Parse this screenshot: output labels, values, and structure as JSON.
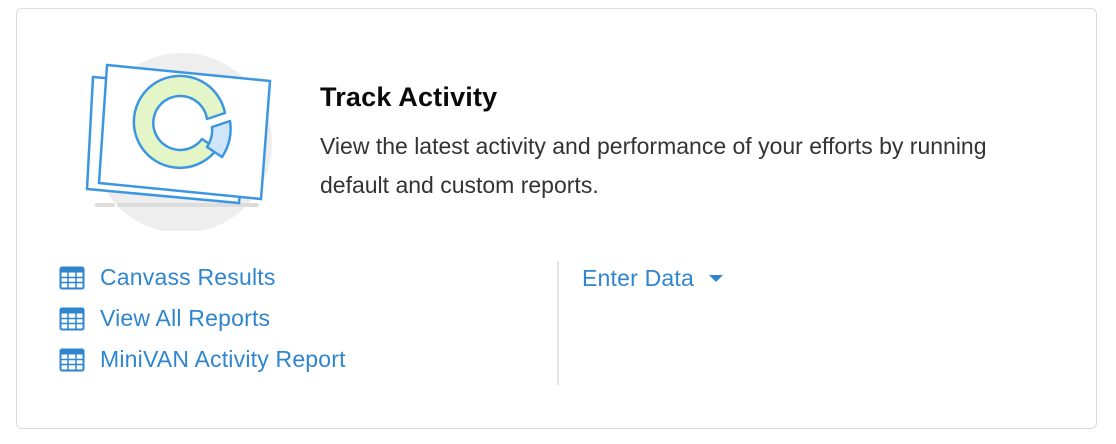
{
  "card": {
    "title": "Track Activity",
    "description": "View the latest activity and performance of your efforts by running default and custom reports.",
    "illustration_icon": "chart-report-illustration"
  },
  "links": [
    {
      "label": "Canvass Results",
      "icon": "table-icon"
    },
    {
      "label": "View All Reports",
      "icon": "table-icon"
    },
    {
      "label": "MiniVAN Activity Report",
      "icon": "table-icon"
    }
  ],
  "enter_data": {
    "label": "Enter Data",
    "icon": "caret-down-icon"
  },
  "colors": {
    "link": "#2f86cf",
    "title": "#0a0a0a",
    "text": "#333333",
    "border": "#dcdcdc",
    "illustration_blue": "#3d97e0",
    "illustration_green": "#e4f6c8"
  }
}
